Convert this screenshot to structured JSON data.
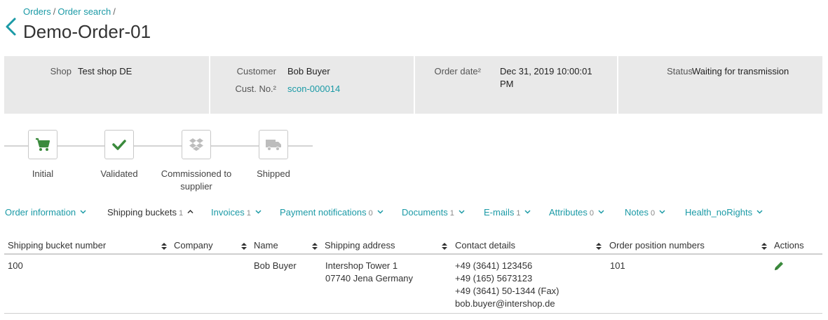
{
  "breadcrumb": {
    "items": [
      "Orders",
      "Order search"
    ],
    "separator": "/"
  },
  "page": {
    "title": "Demo-Order-01"
  },
  "summary": {
    "shop_label": "Shop",
    "shop_value": "Test shop DE",
    "customer_label": "Customer",
    "customer_value": "Bob Buyer",
    "cust_no_label": "Cust. No.²",
    "cust_no_value": "scon-000014",
    "order_date_label": "Order date²",
    "order_date_value": "Dec 31, 2019 10:00:01 PM",
    "status_label": "Status",
    "status_value": "Waiting for transmission"
  },
  "progress": {
    "steps": [
      {
        "label": "Initial",
        "icon": "cart-icon",
        "state": "done"
      },
      {
        "label": "Validated",
        "icon": "check-icon",
        "state": "done"
      },
      {
        "label": "Commissioned to supplier",
        "icon": "dropbox-icon",
        "state": "pending"
      },
      {
        "label": "Shipped",
        "icon": "truck-icon",
        "state": "pending"
      }
    ]
  },
  "tabs": [
    {
      "label": "Order information",
      "count": "",
      "active": false
    },
    {
      "label": "Shipping buckets",
      "count": "1",
      "active": true
    },
    {
      "label": "Invoices",
      "count": "1",
      "active": false
    },
    {
      "label": "Payment notifications",
      "count": "0",
      "active": false
    },
    {
      "label": "Documents",
      "count": "1",
      "active": false
    },
    {
      "label": "E-mails",
      "count": "1",
      "active": false
    },
    {
      "label": "Attributes",
      "count": "0",
      "active": false
    },
    {
      "label": "Notes",
      "count": "0",
      "active": false
    },
    {
      "label": "Health_noRights",
      "count": "",
      "active": false
    }
  ],
  "table": {
    "columns": [
      "Shipping bucket number",
      "Company",
      "Name",
      "Shipping address",
      "Contact details",
      "Order position numbers",
      "Actions"
    ],
    "rows": [
      {
        "bucket_number": "100",
        "company": "",
        "name": "Bob Buyer",
        "address_line1": "Intershop Tower 1",
        "address_line2": "07740 Jena Germany",
        "contact_phone1": "+49 (3641) 123456",
        "contact_phone2": "+49 (165) 5673123",
        "contact_fax": "+49 (3641) 50-1344 (Fax)",
        "contact_email": "bob.buyer@intershop.de",
        "position_numbers": "101"
      }
    ]
  },
  "colors": {
    "accent": "#1b9aa6",
    "success": "#3a8a3c",
    "panel_bg": "#e9e9e9",
    "pending_icon": "#bdbdbd"
  }
}
